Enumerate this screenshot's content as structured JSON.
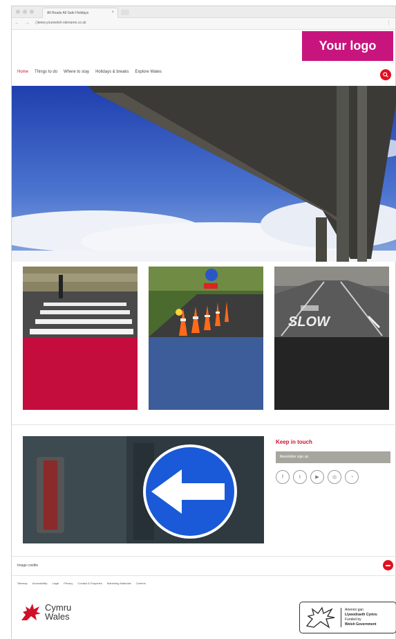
{
  "browser": {
    "tab_title": "All Roads All Safe Holidays",
    "tab_close": "×",
    "url": "www.yourwelsh-sitename.co.uk",
    "nav_arrows": "← → ⟳",
    "menu": "⋮"
  },
  "logo": {
    "text": "Your logo",
    "color": "#c8157e"
  },
  "nav": {
    "items": [
      {
        "label": "Home",
        "active": true
      },
      {
        "label": "Things to do",
        "active": false
      },
      {
        "label": "Where to stay",
        "active": false
      },
      {
        "label": "Holidays & breaks",
        "active": false
      },
      {
        "label": "Explore Wales",
        "active": false
      }
    ],
    "search_icon": "search-icon"
  },
  "cards": [
    {
      "image": "zebra-crossing",
      "panel_color": "#c40d3c"
    },
    {
      "image": "roadworks-cones",
      "panel_color": "#3d5d9a"
    },
    {
      "image": "slow-road",
      "panel_color": "#242424"
    }
  ],
  "keep_in_touch": {
    "title": "Keep in touch",
    "newsletter": "Newsletter sign up",
    "go": "›",
    "social": [
      {
        "icon": "facebook-icon",
        "glyph": "f"
      },
      {
        "icon": "twitter-icon",
        "glyph": "t"
      },
      {
        "icon": "youtube-icon",
        "glyph": "▶"
      },
      {
        "icon": "instagram-icon",
        "glyph": "◎"
      },
      {
        "icon": "rss-icon",
        "glyph": "◔"
      }
    ]
  },
  "credits": {
    "label": "Image credits"
  },
  "footer": {
    "links": [
      "Sitemap",
      "Accessibility",
      "Legal",
      "Privacy",
      "Contact & Enquiries",
      "Marketing Materials",
      "Careers"
    ]
  },
  "brand": {
    "line1": "Cymru",
    "line2": "Wales"
  },
  "gov": {
    "line1": "Ariennir gan",
    "line2": "Llywodraeth Cymru",
    "line3": "Funded by",
    "line4": "Welsh Government"
  },
  "colors": {
    "accent_red": "#e0111f",
    "link_red": "#cc1133"
  }
}
